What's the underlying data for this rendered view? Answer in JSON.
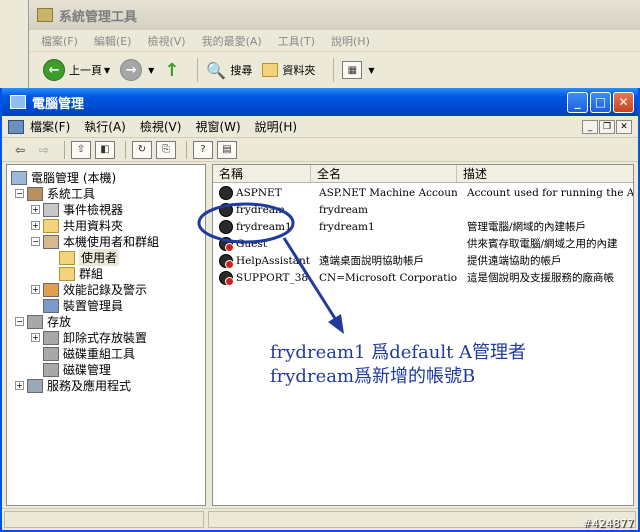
{
  "background_window": {
    "title": "系統管理工具",
    "menu": [
      "檔案(F)",
      "編輯(E)",
      "檢視(V)",
      "我的最愛(A)",
      "工具(T)",
      "說明(H)"
    ],
    "toolbar": {
      "back_label": "上一頁",
      "search_label": "搜尋",
      "folders_label": "資料夾"
    }
  },
  "window": {
    "title": "電腦管理",
    "menu": [
      "檔案(F)",
      "執行(A)",
      "檢視(V)",
      "視窗(W)",
      "說明(H)"
    ]
  },
  "tree": [
    {
      "label": "電腦管理 (本機)"
    },
    {
      "label": "系統工具"
    },
    {
      "label": "事件檢視器"
    },
    {
      "label": "共用資料夾"
    },
    {
      "label": "本機使用者和群組"
    },
    {
      "label": "使用者"
    },
    {
      "label": "群組"
    },
    {
      "label": "效能記錄及警示"
    },
    {
      "label": "裝置管理員"
    },
    {
      "label": "存放"
    },
    {
      "label": "卸除式存放裝置"
    },
    {
      "label": "磁碟重組工具"
    },
    {
      "label": "磁碟管理"
    },
    {
      "label": "服務及應用程式"
    }
  ],
  "list": {
    "columns": [
      "名稱",
      "全名",
      "描述"
    ],
    "rows": [
      {
        "name": "ASPNET",
        "full_name": "ASP.NET Machine Account",
        "description": "Account used for running the ASP.N"
      },
      {
        "name": "frydream",
        "full_name": "frydream",
        "description": ""
      },
      {
        "name": "frydream1",
        "full_name": "frydream1",
        "description": "管理電腦/網域的內建帳戶"
      },
      {
        "name": "Guest",
        "full_name": "",
        "description": "供來賓存取電腦/網域之用的內建"
      },
      {
        "name": "HelpAssistant",
        "full_name": "遠端桌面說明協助帳戶",
        "description": "提供遠端協助的帳戶"
      },
      {
        "name": "SUPPORT_38...",
        "full_name": "CN=Microsoft Corporation...",
        "description": "這是個說明及支援服務的廠商帳"
      }
    ]
  },
  "annotation": {
    "line1": "frydream1 爲default A管理者",
    "line2": "frydream爲新增的帳號B",
    "color": "#1f3b9c"
  },
  "watermark": "#424877"
}
